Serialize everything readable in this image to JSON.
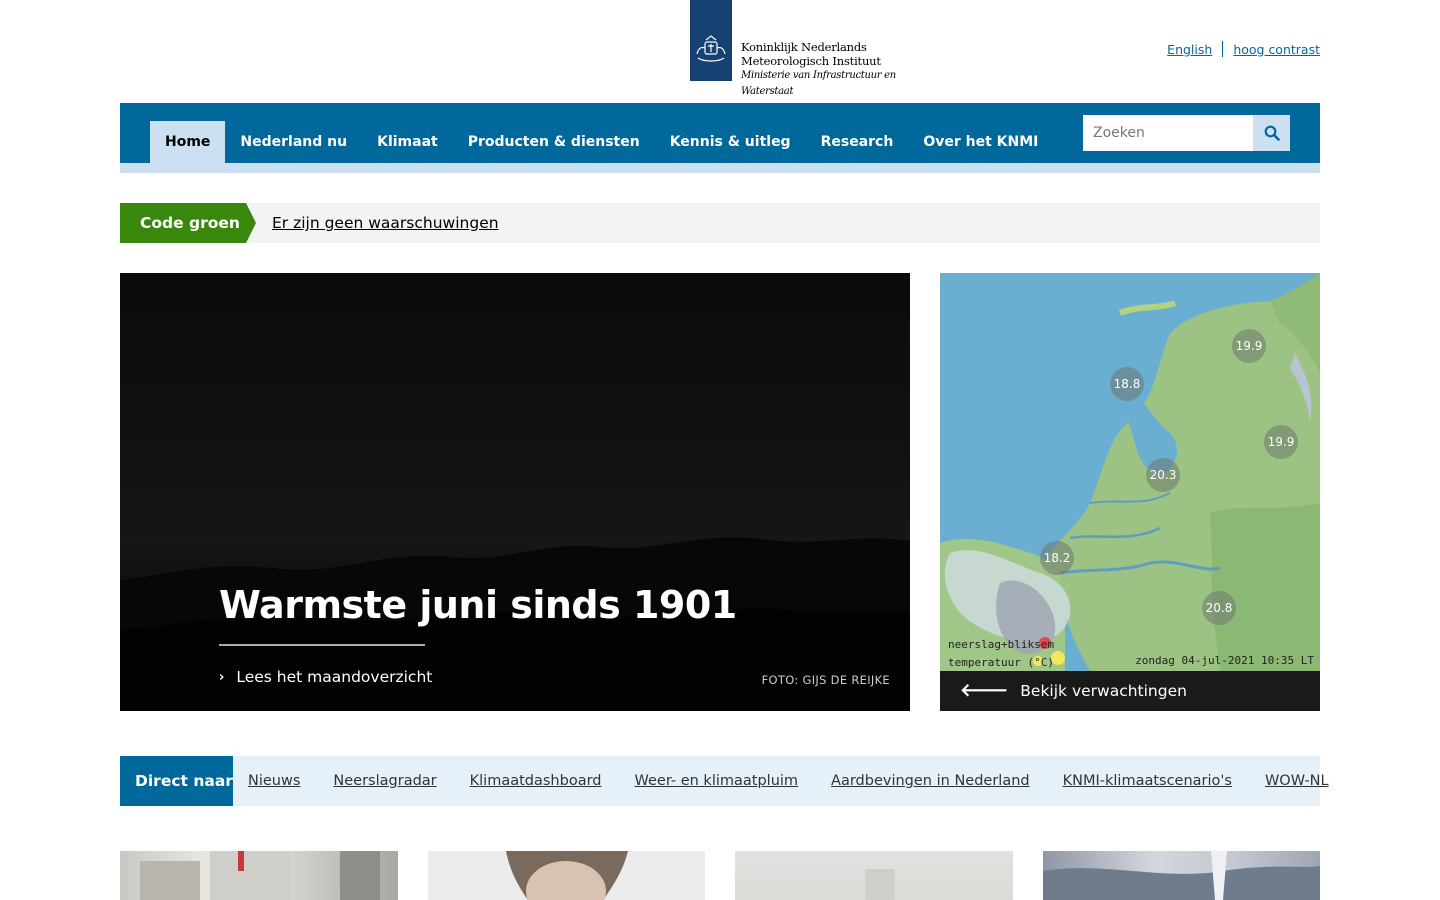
{
  "logo": {
    "line1": "Koninklijk Nederlands",
    "line2": "Meteorologisch Instituut",
    "line3": "Ministerie van Infrastructuur en Waterstaat"
  },
  "top_links": {
    "english": "English",
    "high_contrast": "hoog contrast"
  },
  "nav": {
    "items": [
      {
        "label": "Home",
        "active": true
      },
      {
        "label": "Nederland nu"
      },
      {
        "label": "Klimaat"
      },
      {
        "label": "Producten & diensten"
      },
      {
        "label": "Kennis & uitleg"
      },
      {
        "label": "Research"
      },
      {
        "label": "Over het KNMI"
      }
    ],
    "search_placeholder": "Zoeken"
  },
  "warning": {
    "code": "Code groen",
    "text": "Er zijn geen waarschuwingen",
    "color": "#39870c"
  },
  "hero": {
    "title": "Warmste juni sinds 1901",
    "link": "Lees het maandoverzicht",
    "credit": "FOTO: GIJS DE REIJKE"
  },
  "map": {
    "temperatures": [
      "19.9",
      "18.8",
      "19.9",
      "20.3",
      "18.2",
      "20.8"
    ],
    "legend_line1": "neerslag+bliksem",
    "legend_line2": "temperatuur (°C)",
    "timestamp": "zondag 04-jul-2021 10:35 LT",
    "caption": "Bekijk verwachtingen"
  },
  "direct": {
    "label": "Direct naar",
    "links": [
      "Nieuws",
      "Neerslagradar",
      "Klimaatdashboard",
      "Weer- en klimaatpluim",
      "Aardbevingen in Nederland",
      "KNMI-klimaatscenario's",
      "WOW-NL"
    ]
  },
  "colors": {
    "primary": "#01689b",
    "nav_light": "#cce0f1",
    "logo_blue": "#154273"
  }
}
